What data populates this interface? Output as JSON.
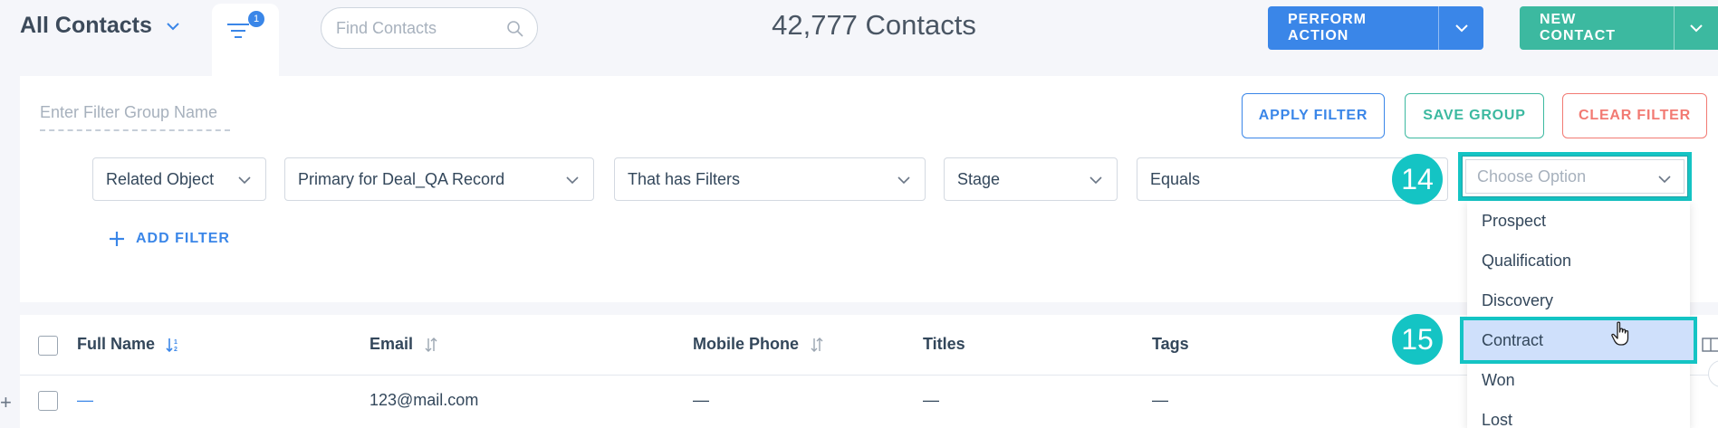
{
  "header": {
    "view_title": "All Contacts",
    "filter_badge_count": "1",
    "search_placeholder": "Find Contacts",
    "contacts_count": "42,777 Contacts",
    "perform_action_label": "PERFORM ACTION",
    "new_contact_label": "NEW CONTACT"
  },
  "filter_panel": {
    "group_name_placeholder": "Enter Filter Group Name",
    "apply_label": "APPLY FILTER",
    "save_group_label": "SAVE GROUP",
    "clear_label": "CLEAR FILTER",
    "conditions": {
      "object": "Related Object",
      "record": "Primary for Deal_QA Record",
      "relation": "That has Filters",
      "field": "Stage",
      "operator": "Equals",
      "value_placeholder": "Choose Option"
    },
    "add_filter_label": "ADD FILTER"
  },
  "dropdown": {
    "options": [
      "Prospect",
      "Qualification",
      "Discovery",
      "Contract",
      "Won",
      "Lost"
    ],
    "selected": "Contract"
  },
  "annotations": {
    "step_a": "14",
    "step_b": "15"
  },
  "table": {
    "columns": [
      "Full Name",
      "Email",
      "Mobile Phone",
      "Titles",
      "Tags"
    ],
    "rows": [
      {
        "full_name": "—",
        "email": "123@mail.com",
        "mobile_phone": "—",
        "titles": "—",
        "tags": "—"
      }
    ]
  },
  "colors": {
    "primary_blue": "#3a86e8",
    "teal": "#3cb9a0",
    "clear_red": "#f27a73",
    "highlight_cyan": "#14c4c4",
    "selected_option_bg": "#cfe0fb"
  }
}
